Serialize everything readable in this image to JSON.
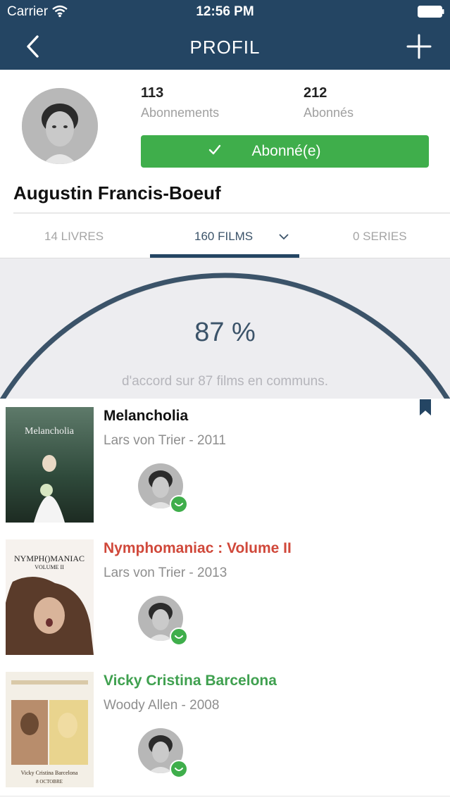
{
  "status": {
    "carrier": "Carrier",
    "time": "12:56 PM"
  },
  "nav": {
    "title": "PROFIL"
  },
  "profile": {
    "following_count": "113",
    "following_label": "Abonnements",
    "followers_count": "212",
    "followers_label": "Abonnés",
    "follow_button": "Abonné(e)",
    "name": "Augustin Francis-Boeuf"
  },
  "tabs": {
    "books": "14 LIVRES",
    "films": "160 FILMS",
    "series": "0 SERIES"
  },
  "gauge": {
    "percent": 87,
    "percent_text": "87 %",
    "caption": "d'accord sur 87 films en communs."
  },
  "films": [
    {
      "title": "Melancholia",
      "subtitle": "Lars von Trier - 2011",
      "title_color": "#111111",
      "poster_text": "Melancholia",
      "bookmarked": true
    },
    {
      "title": "Nymphomaniac : Volume II",
      "subtitle": "Lars von Trier - 2013",
      "title_color": "#d0483a",
      "poster_text": "NYMPH()MANIAC",
      "poster_text2": "VOLUME II",
      "bookmarked": false
    },
    {
      "title": "Vicky Cristina Barcelona",
      "subtitle": "Woody Allen - 2008",
      "title_color": "#3fa04f",
      "poster_text": "Vicky Cristina Barcelona",
      "poster_text2": "8 OCTOBRE",
      "bookmarked": false
    }
  ],
  "colors": {
    "navbar": "#244563",
    "accent_green": "#3fae4b",
    "gauge_arc": "#3b5369"
  }
}
